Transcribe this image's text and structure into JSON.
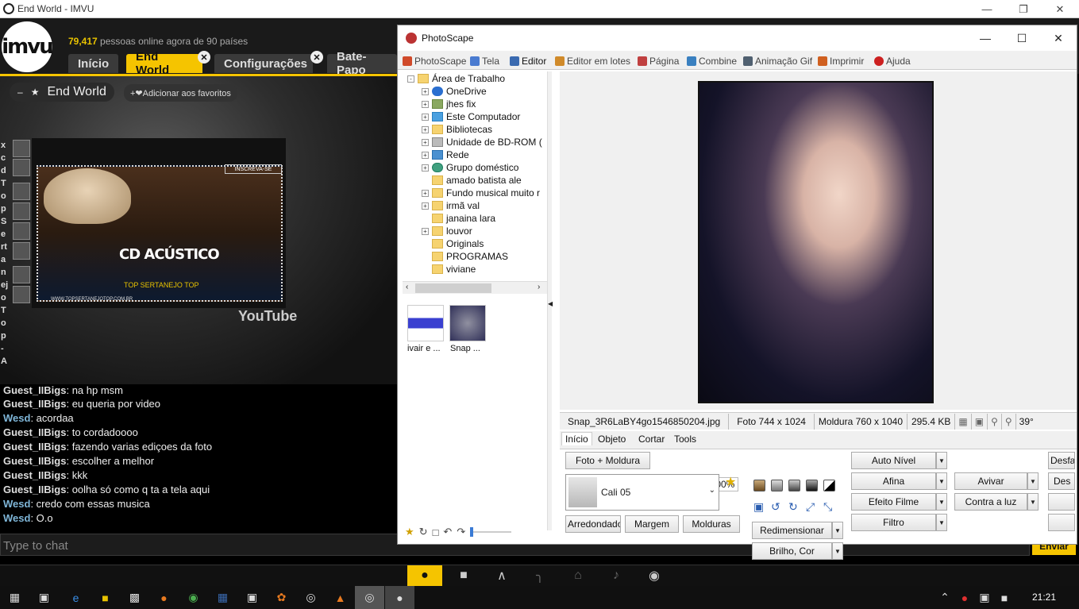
{
  "imvu": {
    "window_title": "End World - IMVU",
    "logo_text": "imvu",
    "online_count": "79,417",
    "online_text": "pessoas online agora de 90 países",
    "nav_tabs": [
      {
        "label": "Início"
      },
      {
        "label": "End World"
      },
      {
        "label": "Configurações"
      },
      {
        "label": "Bate-Papo"
      }
    ],
    "room_title": "End World",
    "add_favorite": "+❤Adicionar aos favoritos",
    "side_text": "xcd Top Sertanejo Top - A",
    "video": {
      "subscribe": "INSCREVA-SE",
      "title": "CD ACÚSTICO",
      "subtitle": "TOP SERTANEJO TOP",
      "site": "WWW.TOPSERTANEJOTOP.COM.BR",
      "youtube": "YouTube"
    },
    "chat": [
      {
        "name": "Guest_IIBigs",
        "text": " na hp msm",
        "type": "guest"
      },
      {
        "name": "Guest_IIBigs",
        "text": " eu queria por video",
        "type": "guest"
      },
      {
        "name": "Wesd",
        "text": " acordaa",
        "type": "wesd"
      },
      {
        "name": "Guest_IIBigs",
        "text": " to cordadoooo",
        "type": "guest"
      },
      {
        "name": "Guest_IIBigs",
        "text": " fazendo varias ediçoes da foto",
        "type": "guest"
      },
      {
        "name": "Guest_IIBigs",
        "text": " escolher a melhor",
        "type": "guest"
      },
      {
        "name": "Guest_IIBigs",
        "text": " kkk",
        "type": "guest"
      },
      {
        "name": "Guest_IIBigs",
        "text": " oolha só como q ta a tela aqui",
        "type": "guest"
      },
      {
        "name": "Wesd",
        "text": " credo com essas musica",
        "type": "wesd"
      },
      {
        "name": "Wesd",
        "text": " O.o",
        "type": "wesd"
      }
    ],
    "chat_placeholder": "Type to chat",
    "send_label": "Enviar",
    "accent": "#f5c400"
  },
  "taskbar": {
    "clock": "21:21"
  },
  "photoscape": {
    "title": "PhotoScape",
    "tabs": [
      {
        "label": "PhotoScape",
        "color": "#d04a2a"
      },
      {
        "label": "Tela",
        "color": "#4a7bd0"
      },
      {
        "label": "Editor",
        "color": "#3a6ab0"
      },
      {
        "label": "Editor em lotes",
        "color": "#d08a2a"
      },
      {
        "label": "Página",
        "color": "#c04040"
      },
      {
        "label": "Combine",
        "color": "#3a80c0"
      },
      {
        "label": "Animação Gif",
        "color": "#506070"
      },
      {
        "label": "Imprimir",
        "color": "#d06020"
      },
      {
        "label": "Ajuda",
        "color": "#cc2020"
      }
    ],
    "tree": [
      {
        "label": "Área de Trabalho",
        "level": 0
      },
      {
        "label": "OneDrive",
        "level": 1
      },
      {
        "label": "jhes fix",
        "level": 1
      },
      {
        "label": "Este Computador",
        "level": 1
      },
      {
        "label": "Bibliotecas",
        "level": 1
      },
      {
        "label": "Unidade de BD-ROM (",
        "level": 1
      },
      {
        "label": "Rede",
        "level": 1
      },
      {
        "label": "Grupo doméstico",
        "level": 1
      },
      {
        "label": "amado batista ale",
        "level": 1
      },
      {
        "label": "Fundo musical muito r",
        "level": 1
      },
      {
        "label": "irmã val",
        "level": 1
      },
      {
        "label": "janaina lara",
        "level": 1
      },
      {
        "label": "louvor",
        "level": 1
      },
      {
        "label": "Originals",
        "level": 1
      },
      {
        "label": "PROGRAMAS",
        "level": 1
      },
      {
        "label": "viviane",
        "level": 1
      }
    ],
    "thumbnails": [
      {
        "label": "ivair e ..."
      },
      {
        "label": "Snap ..."
      }
    ],
    "status": {
      "filename": "Snap_3R6LaBY4go1546850204.jpg",
      "photo_size": "Foto 744 x 1024",
      "frame_size": "Moldura 760 x 1040",
      "file_size": "295.4 KB",
      "zoom": "39°"
    },
    "editor_tabs": [
      "Início",
      "Objeto",
      "Cortar",
      "Tools"
    ],
    "panel": {
      "photo_frame": "Foto + Moldura",
      "zoom_percent": "100%",
      "frame_preset": "Cali 05",
      "rounded": "Arredondado",
      "margin": "Margem",
      "frames": "Molduras",
      "resize": "Redimensionar",
      "brightness": "Brilho, Cor",
      "auto_level": "Auto Nível",
      "sharpen": "Afina",
      "film": "Efeito Filme",
      "filter": "Filtro",
      "vivid": "Avivar",
      "backlight": "Contra a luz",
      "undo": "Desfa",
      "redo": "Des"
    }
  }
}
